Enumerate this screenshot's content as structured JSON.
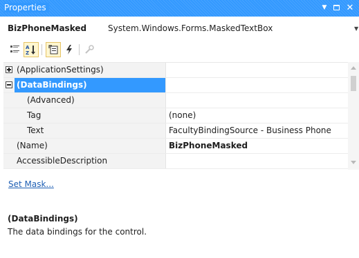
{
  "window": {
    "title": "Properties",
    "accent_color": "#3399ff"
  },
  "object_selector": {
    "name": "BizPhoneMasked",
    "type": "System.Windows.Forms.MaskedTextBox"
  },
  "toolbar": {
    "buttons": [
      {
        "icon": "categorized-icon",
        "active": false
      },
      {
        "icon": "alphabetical-icon",
        "active": true
      },
      {
        "icon": "properties-icon",
        "active": true
      },
      {
        "icon": "events-lightning-icon",
        "active": false
      },
      {
        "icon": "property-pages-wrench-icon",
        "active": false
      }
    ]
  },
  "grid": {
    "rows": [
      {
        "name": "(ApplicationSettings)",
        "value": "",
        "expander": "plus"
      },
      {
        "name": "(DataBindings)",
        "value": "",
        "expander": "minus",
        "selected": true
      },
      {
        "name": "(Advanced)",
        "value": ""
      },
      {
        "name": "Tag",
        "value": "(none)"
      },
      {
        "name": "Text",
        "value": "FacultyBindingSource - Business Phone"
      },
      {
        "name": "(Name)",
        "value": "BizPhoneMasked",
        "value_bold": true
      },
      {
        "name": "AccessibleDescription",
        "value": ""
      }
    ]
  },
  "commands": {
    "set_mask_label": "Set Mask..."
  },
  "description": {
    "title": "(DataBindings)",
    "text": "The data bindings for the control."
  }
}
